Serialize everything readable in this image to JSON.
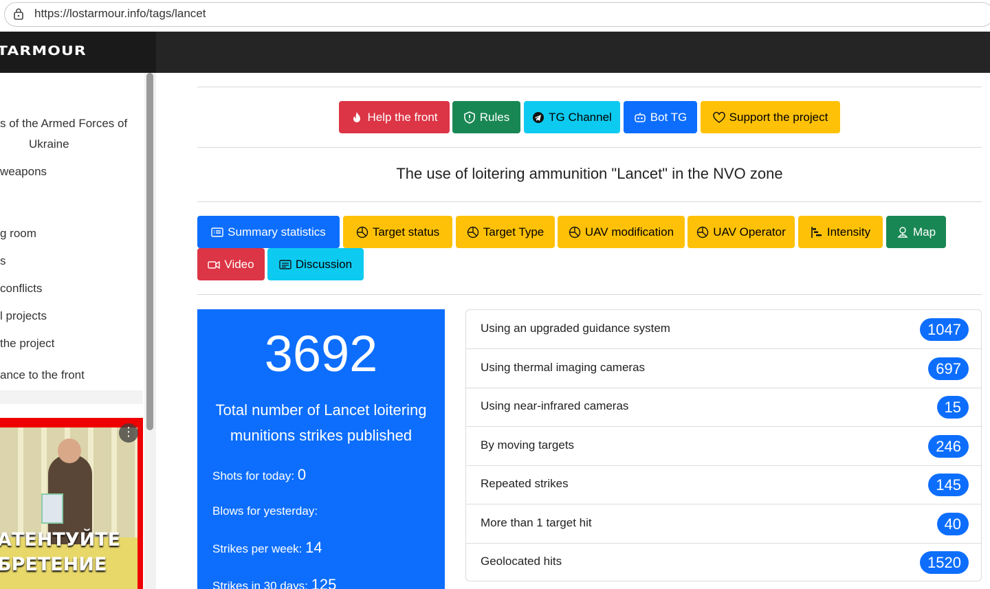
{
  "browser": {
    "url": "https://lostarmour.info/tags/lancet"
  },
  "navbar": {
    "brand": "TARMOUR"
  },
  "sidebar": {
    "items": [
      {
        "label": "s of the Armed Forces of"
      },
      {
        "label": "Ukraine"
      },
      {
        "label": "weapons"
      },
      {
        "label": "g room"
      },
      {
        "label": "s"
      },
      {
        "label": "conflicts"
      },
      {
        "label": "l projects"
      },
      {
        "label": "the project"
      },
      {
        "label": "ance to the front"
      }
    ],
    "video": {
      "caption_line1": "АТЕНТУЙТЕ",
      "caption_line2": "БРЕТЕНИЕ"
    }
  },
  "top_buttons": {
    "help_front": "Help the front",
    "rules": "Rules",
    "tg_channel": "TG Channel",
    "bot_tg": "Bot TG",
    "support": "Support the project"
  },
  "page_title": "The use of loitering ammunition \"Lancet\" in the NVO zone",
  "tabs": {
    "summary": "Summary statistics",
    "target_status": "Target status",
    "target_type": "Target Type",
    "uav_modification": "UAV modification",
    "uav_operator": "UAV Operator",
    "intensity": "Intensity",
    "map": "Map",
    "video": "Video",
    "discussion": "Discussion"
  },
  "summary": {
    "total": "3692",
    "total_desc": "Total number of Lancet loitering munitions strikes published",
    "today_label": "Shots for today:",
    "today_value": "0",
    "yesterday_label": "Blows for yesterday:",
    "week_label": "Strikes per week:",
    "week_value": "14",
    "days30_label": "Strikes in 30 days:",
    "days30_value": "125"
  },
  "stats_list": [
    {
      "label": "Using an upgraded guidance system",
      "value": "1047"
    },
    {
      "label": "Using thermal imaging cameras",
      "value": "697"
    },
    {
      "label": "Using near-infrared cameras",
      "value": "15"
    },
    {
      "label": "By moving targets",
      "value": "246"
    },
    {
      "label": "Repeated strikes",
      "value": "145"
    },
    {
      "label": "More than 1 target hit",
      "value": "40"
    },
    {
      "label": "Geolocated hits",
      "value": "1520"
    }
  ]
}
